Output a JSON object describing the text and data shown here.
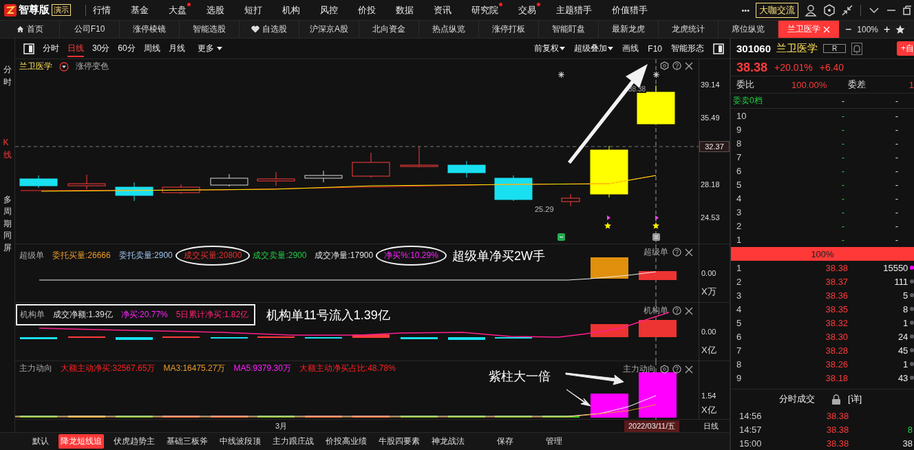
{
  "menu_bar": {
    "logo": "智尊版",
    "badge": "演示",
    "items": [
      {
        "label": "行情",
        "dot": false
      },
      {
        "label": "基金",
        "dot": false
      },
      {
        "label": "大盘",
        "dot": true
      },
      {
        "label": "选股",
        "dot": false
      },
      {
        "label": "短打",
        "dot": false
      },
      {
        "label": "机构",
        "dot": false
      },
      {
        "label": "风控",
        "dot": false
      },
      {
        "label": "价投",
        "dot": false
      },
      {
        "label": "数据",
        "dot": false
      },
      {
        "label": "资讯",
        "dot": false
      },
      {
        "label": "研究院",
        "dot": true
      },
      {
        "label": "交易",
        "dot": true
      },
      {
        "label": "主题猎手",
        "dot": false
      },
      {
        "label": "价值猎手",
        "dot": false
      }
    ],
    "more": "•••",
    "exchange_button": "大咖交流"
  },
  "tabs": [
    {
      "label": "首页",
      "selected": false
    },
    {
      "label": "公司F10",
      "selected": false
    },
    {
      "label": "涨停棱镜",
      "selected": false
    },
    {
      "label": "智能选股",
      "selected": false
    },
    {
      "label": "自选股",
      "selected": false
    },
    {
      "label": "沪深京A股",
      "selected": false
    },
    {
      "label": "北向资金",
      "selected": false
    },
    {
      "label": "热点纵览",
      "selected": false
    },
    {
      "label": "涨停打板",
      "selected": false
    },
    {
      "label": "智能盯盘",
      "selected": false
    },
    {
      "label": "最新龙虎",
      "selected": false
    },
    {
      "label": "龙虎统计",
      "selected": false
    },
    {
      "label": "席位纵览",
      "selected": false
    },
    {
      "label": "兰卫医学",
      "selected": true
    }
  ],
  "zoom": {
    "minus": "−",
    "value": "100%",
    "plus": "+"
  },
  "side_nav": [
    {
      "label": "分时",
      "selected": false
    },
    {
      "label": "K线",
      "selected": true
    },
    {
      "label": "多周期同屏",
      "selected": false
    }
  ],
  "period_tabs": [
    {
      "label": "分时",
      "selected": false
    },
    {
      "label": "日线",
      "selected": true
    },
    {
      "label": "30分",
      "selected": false
    },
    {
      "label": "60分",
      "selected": false
    },
    {
      "label": "周线",
      "selected": false
    },
    {
      "label": "月线",
      "selected": false
    }
  ],
  "more_periods": "更多",
  "tools": [
    {
      "label": "前复权",
      "dropdown": true
    },
    {
      "label": "超级叠加",
      "dropdown": true
    },
    {
      "label": "画线",
      "dropdown": false
    },
    {
      "label": "F10",
      "dropdown": false
    },
    {
      "label": "智能形态",
      "dropdown": false
    }
  ],
  "main_chart": {
    "stock_name": "兰卫医学",
    "toggle_label": "涨停变色",
    "high_label": "38.38",
    "low_label": "25.29",
    "current_price": "32.37",
    "note_arrow": true,
    "y_labels": [
      "39.14",
      "35.49",
      "28.18",
      "24.53"
    ]
  },
  "indicators": [
    {
      "kind": "super",
      "name": "超级单",
      "boxed": false,
      "title_right": "超级单",
      "note": "超级单净买2W手",
      "zero": "0.00",
      "unit": "X万",
      "legend": [
        {
          "text": "委托买量:26666",
          "color": "#e89a2c",
          "circled": false
        },
        {
          "text": "委托卖量:2900",
          "color": "#9cc4ec",
          "circled": false
        },
        {
          "text": "成交买量:20800",
          "color": "#e83030",
          "circled": true
        },
        {
          "text": "成交卖量:2900",
          "color": "#22cc44",
          "circled": false
        },
        {
          "text": "成交净量:17900",
          "color": "#e0e0e0",
          "circled": false
        },
        {
          "text": "净买%:10.29%",
          "color": "#ff22ff",
          "circled": true
        }
      ]
    },
    {
      "kind": "institution",
      "name": "机构单",
      "boxed": true,
      "title_right": "机构单",
      "note": "机构单11号流入1.39亿",
      "zero": "0.00",
      "unit": "X亿",
      "legend": [
        {
          "text": "成交净额:1.39亿",
          "color": "#e0e0e0",
          "circled": false
        },
        {
          "text": "净买:20.77%",
          "color": "#ff22ff",
          "circled": false
        },
        {
          "text": "5日累计净买:1.82亿",
          "color": "#ff2277",
          "circled": false
        }
      ]
    },
    {
      "kind": "main_force",
      "name": "主力动向",
      "boxed": false,
      "title_right": "主力动向",
      "note": "紫柱大一倍",
      "zero": "1.54",
      "unit": "X亿",
      "legend": [
        {
          "text": "大额主动净买:32567.65万",
          "color": "#ff2020",
          "circled": false
        },
        {
          "text": "MA3:16475.27万",
          "color": "#e89a2c",
          "circled": false
        },
        {
          "text": "MA5:9379.30万",
          "color": "#ff22ff",
          "circled": false
        },
        {
          "text": "大额主动净买占比:48.78%",
          "color": "#ff2020",
          "circled": false
        }
      ]
    }
  ],
  "date_axis": {
    "month": "3月",
    "cursor_date": "2022/03/11/五",
    "period": "日线"
  },
  "bottom_tabs": [
    {
      "label": "默认",
      "selected": false
    },
    {
      "label": "降龙短线追",
      "selected": true
    },
    {
      "label": "伏虎趋势主",
      "selected": false
    },
    {
      "label": "基础三板斧",
      "selected": false
    },
    {
      "label": "中线波段顶",
      "selected": false
    },
    {
      "label": "主力跟庄战",
      "selected": false
    },
    {
      "label": "价投高业绩",
      "selected": false
    },
    {
      "label": "牛股四要素",
      "selected": false
    },
    {
      "label": "神龙战法",
      "selected": false
    },
    {
      "label": "保存",
      "selected": false
    },
    {
      "label": "管理",
      "selected": false
    }
  ],
  "quote": {
    "code": "301060",
    "name": "兰卫医学",
    "tag": "R",
    "add_button": "+自",
    "price": "38.38",
    "change_pct": "+20.01%",
    "change": "+6.40",
    "ratio_label": "委比",
    "ratio": "100.00%",
    "diff_label": "委差",
    "diff": "1",
    "sell_summary": {
      "label": "委卖0档",
      "price": "-",
      "volume": "-"
    },
    "asks": [
      {
        "level": "10",
        "price": "-",
        "volume": "-"
      },
      {
        "level": "9",
        "price": "-",
        "volume": "-"
      },
      {
        "level": "8",
        "price": "-",
        "volume": "-"
      },
      {
        "level": "7",
        "price": "-",
        "volume": "-"
      },
      {
        "level": "6",
        "price": "-",
        "volume": "-"
      },
      {
        "level": "5",
        "price": "-",
        "volume": "-"
      },
      {
        "level": "4",
        "price": "-",
        "volume": "-"
      },
      {
        "level": "3",
        "price": "-",
        "volume": "-"
      },
      {
        "level": "2",
        "price": "-",
        "volume": "-"
      },
      {
        "level": "1",
        "price": "-",
        "volume": "-"
      }
    ],
    "bar": {
      "label": "100%",
      "level": 1
    },
    "bids": [
      {
        "level": "1",
        "price": "38.38",
        "volume": "15550",
        "color": "#ff00ff"
      },
      {
        "level": "2",
        "price": "38.37",
        "volume": "111",
        "color": "#5a5a60"
      },
      {
        "level": "3",
        "price": "38.36",
        "volume": "5",
        "color": "#5a5a60"
      },
      {
        "level": "4",
        "price": "38.35",
        "volume": "8",
        "color": "#5a5a60"
      },
      {
        "level": "5",
        "price": "38.32",
        "volume": "1",
        "color": "#5a5a60"
      },
      {
        "level": "6",
        "price": "38.30",
        "volume": "24",
        "color": "#5a5a60"
      },
      {
        "level": "7",
        "price": "38.28",
        "volume": "45",
        "color": "#5a5a60"
      },
      {
        "level": "8",
        "price": "38.26",
        "volume": "1",
        "color": "#5a5a60"
      },
      {
        "level": "9",
        "price": "38.18",
        "volume": "43",
        "color": "#5a5a60"
      }
    ],
    "trades_title": "分时成交",
    "trades_link": "[详]",
    "trades": [
      {
        "time": "14:56",
        "price": "38.38"
      },
      {
        "time": "14:57",
        "price": "38.38",
        "volume": "8",
        "color": "#22cc44"
      },
      {
        "time": "15:00",
        "price": "38.38",
        "volume": "38",
        "color": "#e8e8e8"
      }
    ]
  }
}
